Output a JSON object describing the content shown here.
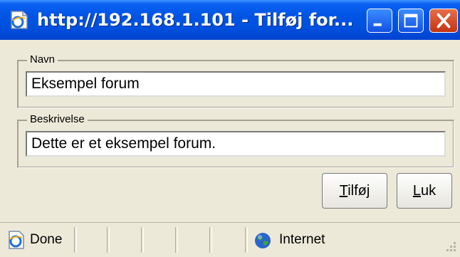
{
  "window": {
    "title": "http://192.168.1.101 - Tilføj for...",
    "accent": "#0054e3",
    "close_color": "#d8491f"
  },
  "form": {
    "name_legend": "Navn",
    "name_value": "Eksempel forum",
    "description_legend": "Beskrivelse",
    "description_value": "Dette er et eksempel forum."
  },
  "buttons": {
    "add": {
      "mnemonic": "T",
      "rest": "ilføj"
    },
    "close": {
      "mnemonic": "L",
      "rest": "uk"
    }
  },
  "statusbar": {
    "status": "Done",
    "zone": "Internet",
    "status_icon": "ie-page-icon",
    "zone_icon": "globe-icon"
  }
}
